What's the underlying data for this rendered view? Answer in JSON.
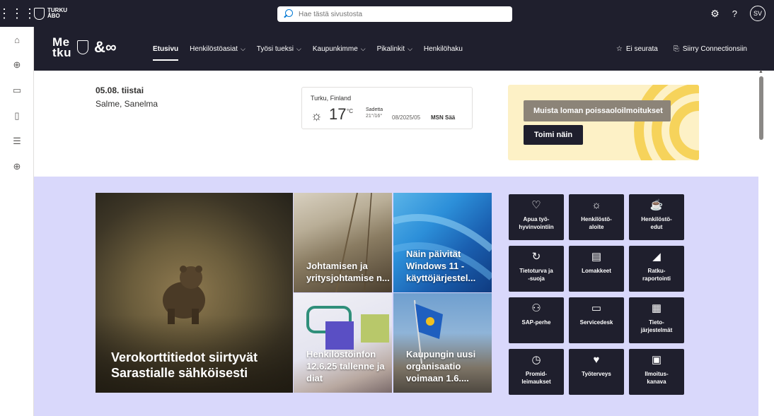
{
  "suitebar": {
    "logo_text": "TURKU ÅBO",
    "logo_line1": "TURKU",
    "logo_line2": "ÅBO",
    "search_placeholder": "Hae tästä sivustosta",
    "avatar_initials": "SV",
    "help_label": "?"
  },
  "appbar": {
    "items": [
      "home-icon",
      "globe-icon",
      "news-icon",
      "file-icon",
      "list-icon",
      "add-icon"
    ]
  },
  "hubnav": {
    "brand_top": "Me",
    "brand_bottom": "tku",
    "nav": [
      {
        "label": "Etusivu",
        "active": true,
        "has_dropdown": false
      },
      {
        "label": "Henkilöstöasiat",
        "has_dropdown": true
      },
      {
        "label": "Työsi tueksi",
        "has_dropdown": true
      },
      {
        "label": "Kaupunkimme",
        "has_dropdown": true
      },
      {
        "label": "Pikalinkit",
        "has_dropdown": true
      },
      {
        "label": "Henkilöhaku",
        "has_dropdown": false
      }
    ],
    "follow_label": "Ei seurata",
    "connections_label": "Siirry Connectionsiin"
  },
  "info": {
    "date": "05.08. tiistai",
    "names": "Salme, Sanelma"
  },
  "weather": {
    "location": "Turku, Finland",
    "temperature": "17",
    "unit": "°C",
    "condition": "Sadetta",
    "range": "21°/16°",
    "date": "08/2025/05",
    "source": "MSN Sää"
  },
  "promo": {
    "button1": "Muista loman poissaoloilmoitukset",
    "button2": "Toimi näin"
  },
  "news": {
    "hero_title": "Verokorttitiedot siirtyvät Sarastialle sähköisesti",
    "tiles": [
      "Johtamisen ja yritysjohtamise n...",
      "Näin päivität Windows 11 -käyttöjärjestel...",
      "Henkilöstöinfon 12.6.25 tallenne ja diat",
      "Kaupungin uusi organisaatio voimaan 1.6...."
    ]
  },
  "quicklinks": [
    {
      "label": "Apua työ-\nhyvinvointiin",
      "icon": "heart-icon",
      "glyph": "♡"
    },
    {
      "label": "Henkilöstö-\naloite",
      "icon": "lightbulb-icon",
      "glyph": "☼"
    },
    {
      "label": "Henkilöstö-\nedut",
      "icon": "coffee-icon",
      "glyph": "☕"
    },
    {
      "label": "Tietoturva ja\n-suoja",
      "icon": "refresh-icon",
      "glyph": "↻"
    },
    {
      "label": "Lomakkeet",
      "icon": "document-icon",
      "glyph": "▤"
    },
    {
      "label": "Ratku-\nraportointi",
      "icon": "chart-icon",
      "glyph": "◢"
    },
    {
      "label": "SAP-perhe",
      "icon": "people-icon",
      "glyph": "⚇"
    },
    {
      "label": "Servicedesk",
      "icon": "monitor-icon",
      "glyph": "▭"
    },
    {
      "label": "Tieto-\njärjestelmät",
      "icon": "grid-icon",
      "glyph": "▦"
    },
    {
      "label": "Promid-\nleimaukset",
      "icon": "clock-icon",
      "glyph": "◷"
    },
    {
      "label": "Työterveys",
      "icon": "heartbeat-icon",
      "glyph": "♥"
    },
    {
      "label": "Ilmoitus-\nkanava",
      "icon": "chat-icon",
      "glyph": "▣"
    }
  ]
}
